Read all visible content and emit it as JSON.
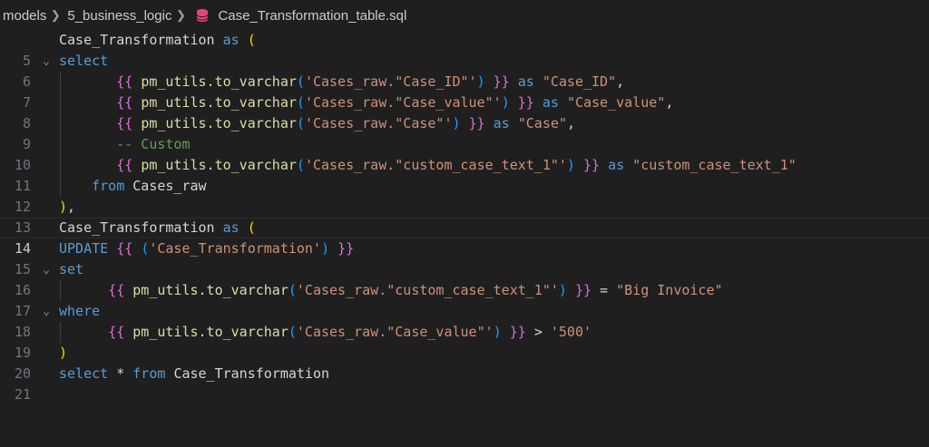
{
  "breadcrumb": {
    "folder1": "models",
    "folder2": "5_business_logic",
    "file": "Case_Transformation_table.sql",
    "file_icon": "database-icon",
    "icon_color": "#e8467c"
  },
  "editor": {
    "current_line": 14,
    "lines": [
      {
        "n": "5",
        "code": "Case_Transformation as ("
      },
      {
        "n": "6",
        "code": "select"
      },
      {
        "n": "7",
        "code": "{{ pm_utils.to_varchar('Cases_raw.\"Case_ID\"') }} as \"Case_ID\","
      },
      {
        "n": "8",
        "code": "{{ pm_utils.to_varchar('Cases_raw.\"Case_value\"') }} as \"Case_value\","
      },
      {
        "n": "9",
        "code": "{{ pm_utils.to_varchar('Cases_raw.\"Case\"') }} as \"Case\","
      },
      {
        "n": "10",
        "code": "-- Custom"
      },
      {
        "n": "11",
        "code": "{{ pm_utils.to_varchar('Cases_raw.\"custom_case_text_1\"') }} as \"custom_case_text_1\""
      },
      {
        "n": "12",
        "code": "from Cases_raw"
      },
      {
        "n": "13",
        "code": "),"
      },
      {
        "n": "14",
        "code": "Case_Transformation as ("
      },
      {
        "n": "15",
        "code": "UPDATE {{ ('Case_Transformation') }}"
      },
      {
        "n": "16",
        "code": "set"
      },
      {
        "n": "17",
        "code": "{{ pm_utils.to_varchar('Cases_raw.\"custom_case_text_1\"') }} = \"Big Invoice\""
      },
      {
        "n": "18",
        "code": "where"
      },
      {
        "n": "19",
        "code": "{{ pm_utils.to_varchar('Cases_raw.\"Case_value\"') }} > '500'"
      },
      {
        "n": "20",
        "code": ")"
      },
      {
        "n": "21",
        "code": "select * from Case_Transformation"
      }
    ]
  }
}
